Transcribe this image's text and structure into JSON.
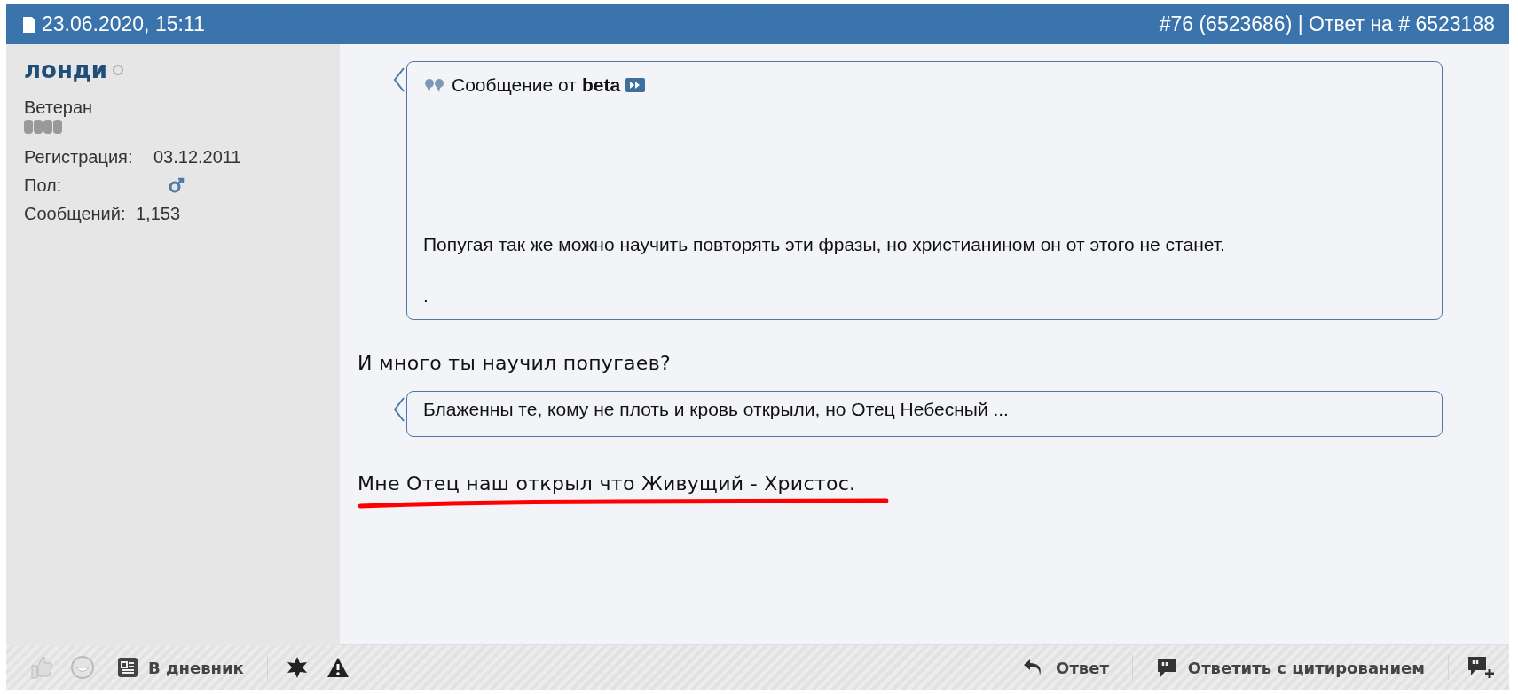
{
  "post_header": {
    "date": "23.06.2020, 15:11",
    "post_info": "#76 (6523686) | Ответ на # 6523188"
  },
  "user": {
    "name": "лонди",
    "online": false,
    "rank": "Ветеран",
    "details": [
      {
        "kind": "text",
        "label": "Регистрация:",
        "value": "03.12.2011"
      },
      {
        "kind": "gender",
        "label": "Пол:"
      },
      {
        "kind": "text",
        "label": "Сообщений:",
        "value": "1,153"
      }
    ]
  },
  "content": [
    {
      "kind": "quote",
      "prefix": "Сообщение от",
      "author": "beta",
      "paragraphs": [
        "Попугая так же можно научить повторять эти фразы, но христианином он от этого не станет.",
        "."
      ]
    },
    {
      "kind": "text",
      "text": "И много ты научил попугаев?"
    },
    {
      "kind": "quote",
      "paragraphs": [
        "Блаженны те, кому не плоть и кровь открыли, но Отец Небесный ..."
      ]
    },
    {
      "kind": "text",
      "text": "Мне Отец наш открыл что Живущий - Христос.",
      "underlined": true
    }
  ],
  "footer": {
    "diary": "В дневник",
    "reply": "Ответ",
    "quote_reply": "Ответить с цитированием"
  }
}
